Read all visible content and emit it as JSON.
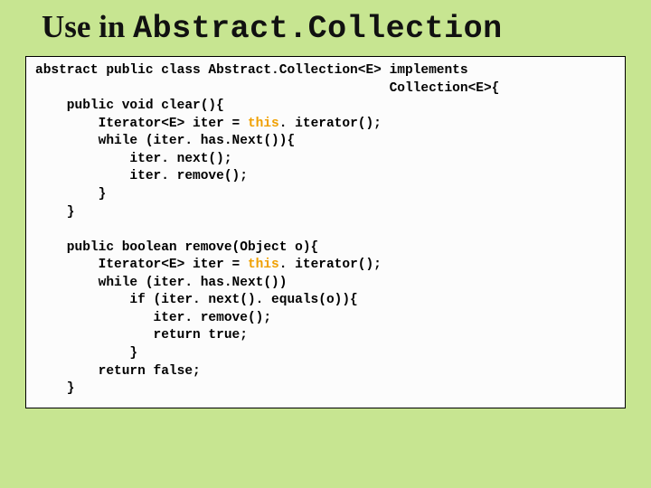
{
  "title": {
    "serif": "Use in ",
    "mono": "Abstract.Collection"
  },
  "code": {
    "l1a": "abstract public class Abstract.Collection<E> implements",
    "l1b": "                                             Collection<E>{",
    "l2": "    public void clear(){",
    "l3a": "        Iterator<E> iter = ",
    "this1": "this",
    "l3b": ". iterator();",
    "l4": "        while (iter. has.Next()){",
    "l5": "            iter. next();",
    "l6": "            iter. remove();",
    "l7": "        }",
    "l8": "    }",
    "blank1": "",
    "l9": "    public boolean remove(Object o){",
    "l10a": "        Iterator<E> iter = ",
    "this2": "this",
    "l10b": ". iterator();",
    "l11": "        while (iter. has.Next())",
    "l12": "            if (iter. next(). equals(o)){",
    "l13": "               iter. remove();",
    "l14": "               return true;",
    "l15": "            }",
    "l16": "        return false;",
    "l17": "    }"
  }
}
